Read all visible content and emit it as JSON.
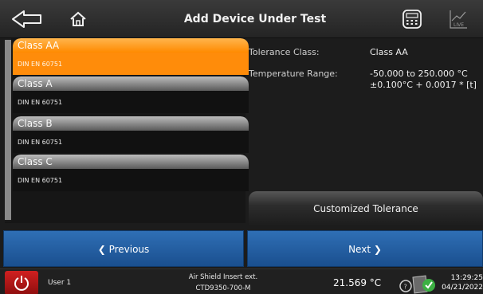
{
  "header": {
    "title": "Add Device Under Test",
    "icons": [
      "arrow-left-icon",
      "home-icon",
      "calculator-icon",
      "live-chart-icon"
    ]
  },
  "classes": [
    {
      "name": "Class AA",
      "standard": "DIN EN 60751",
      "selected": true
    },
    {
      "name": "Class A",
      "standard": "DIN EN 60751",
      "selected": false
    },
    {
      "name": "Class B",
      "standard": "DIN EN 60751",
      "selected": false
    },
    {
      "name": "Class C",
      "standard": "DIN EN 60751",
      "selected": false
    }
  ],
  "details": {
    "tolerance_class_label": "Tolerance Class:",
    "tolerance_class_value": "Class AA",
    "temperature_range_label": "Temperature Range:",
    "temperature_range_value": "-50.000 to 250.000 °C",
    "tolerance_formula": "±0.100°C + 0.0017 * [t]"
  },
  "buttons": {
    "customized_tolerance": "Customized Tolerance",
    "previous": "❮ Previous",
    "next": "Next ❯"
  },
  "footer": {
    "user": "User 1",
    "device_line1": "Air Shield Insert ext.",
    "device_line2": "CTD9350-700-M",
    "temperature": "21.569 °C",
    "time": "13:29:25",
    "date": "04/21/2022"
  },
  "colors": {
    "selected_accent": "#ff8c0a",
    "nav_button": "#2160a5",
    "power_button": "#c41a1a",
    "status_ok": "#3cb043"
  }
}
